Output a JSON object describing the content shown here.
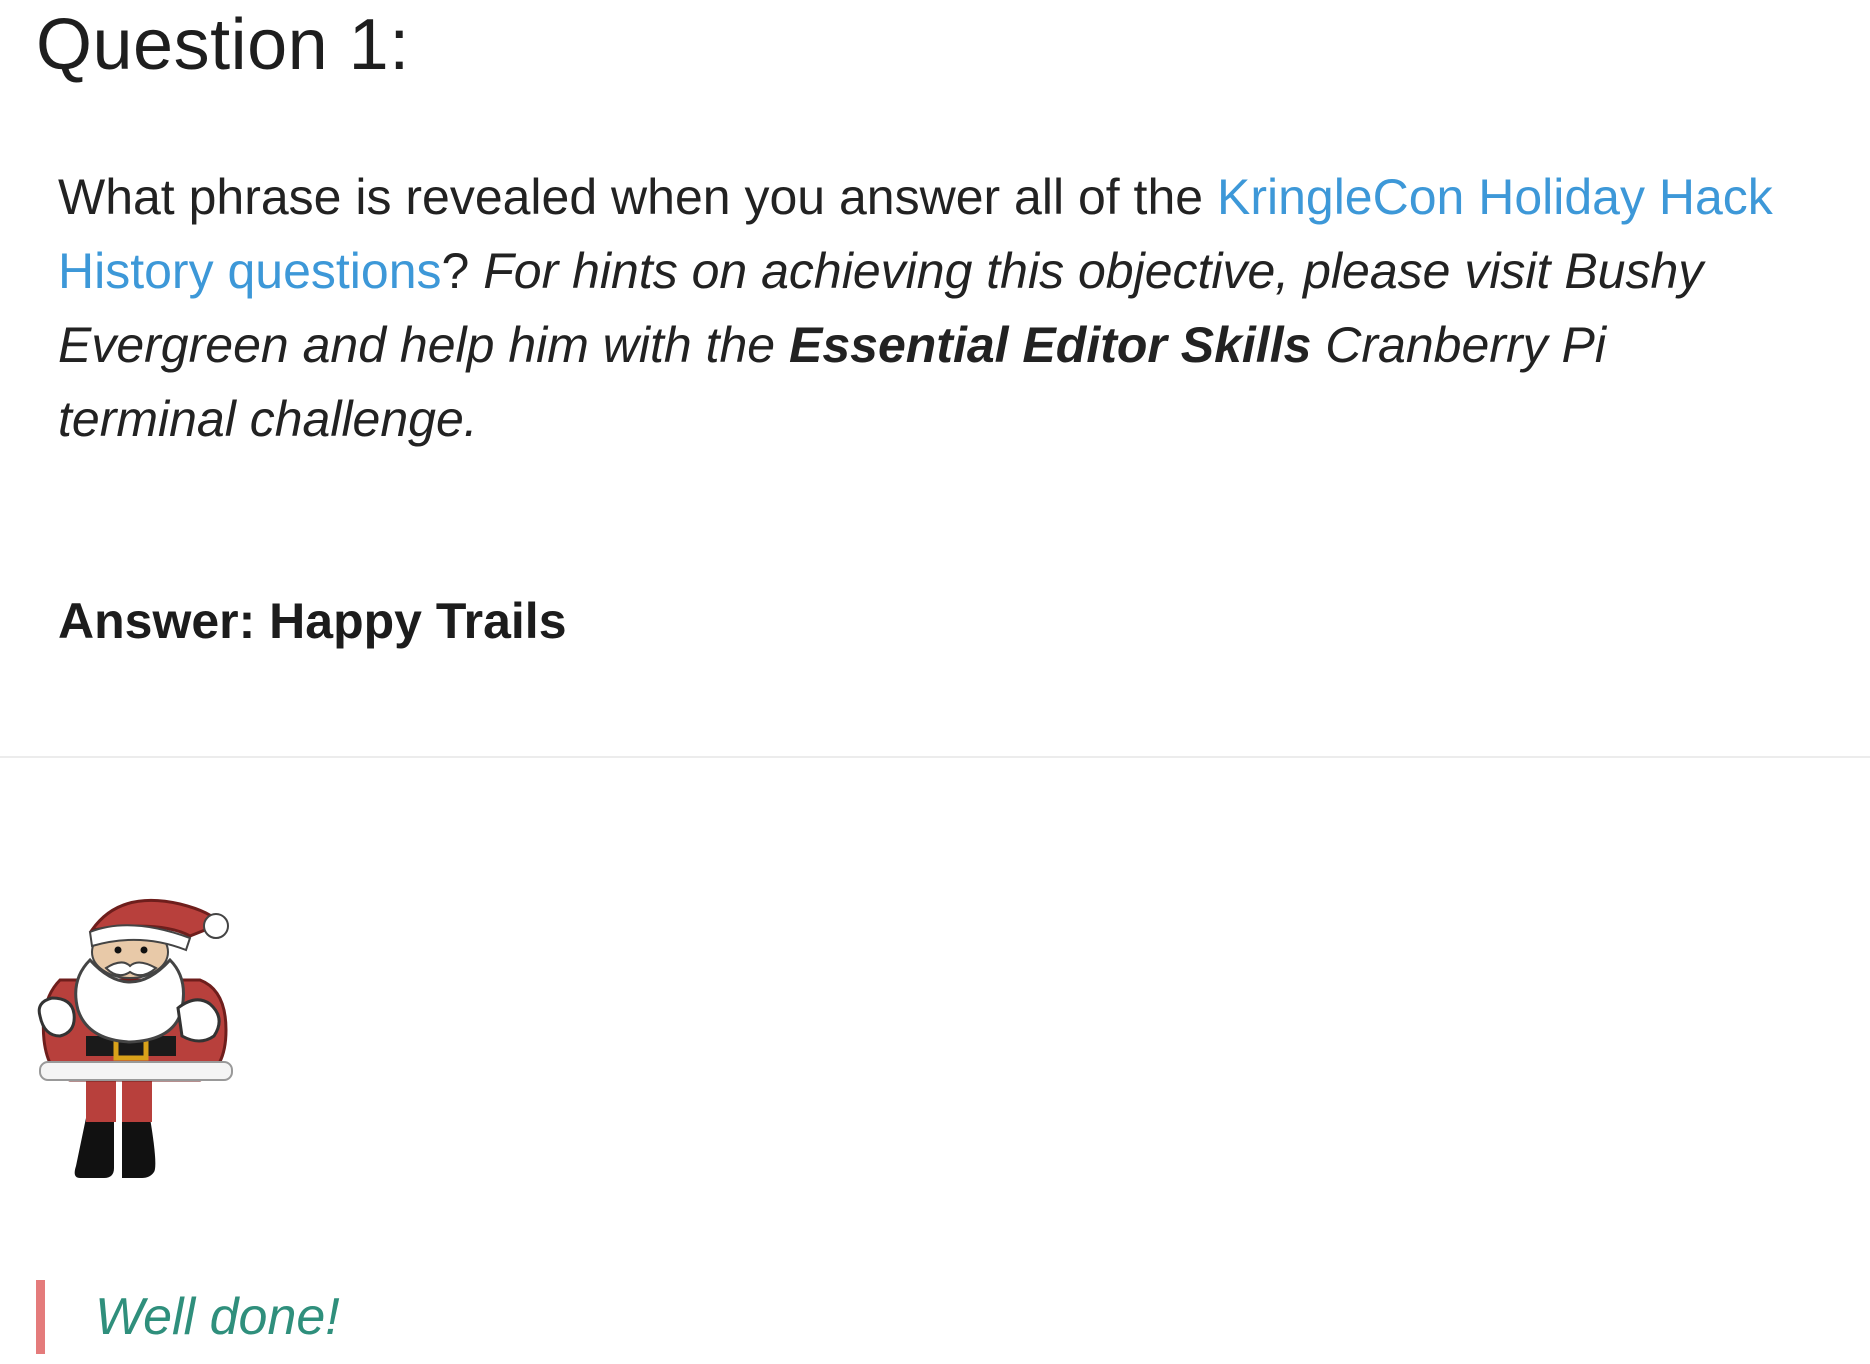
{
  "page": {
    "title": "Question 1:"
  },
  "question": {
    "text_before_link": "What phrase is revealed when you answer all of the ",
    "link_text": "KringleCon Holiday Hack History questions",
    "text_after_link": "?",
    "hint_before_bold": "For hints on achieving this objective, please visit Bushy Evergreen and help him with the ",
    "hint_bold": "Essential Editor Skills",
    "hint_after_bold": " Cranberry Pi terminal challenge."
  },
  "answer": {
    "text": "Answer: Happy Trails"
  },
  "illustration": {
    "icon": "santa-icon"
  },
  "quote": {
    "text": "Well done!"
  },
  "colors": {
    "link": "#3d98d8",
    "quote_text": "#2f8f7c",
    "quote_border": "#e47b7b",
    "santa_red": "#b8403c"
  }
}
